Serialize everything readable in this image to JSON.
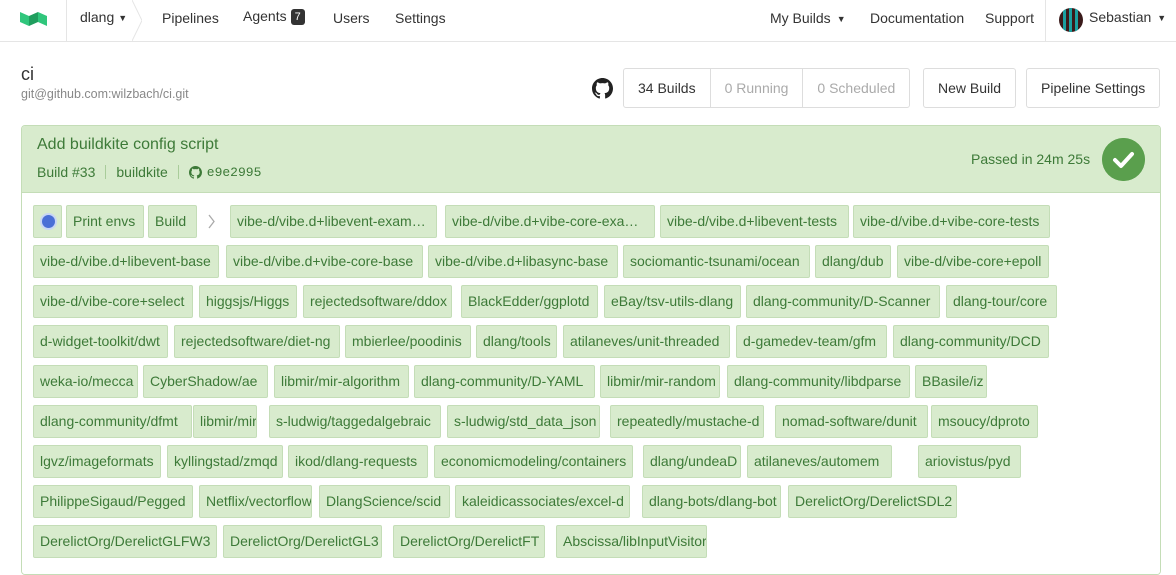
{
  "nav": {
    "org": "dlang",
    "links": {
      "pipelines": "Pipelines",
      "agents": "Agents",
      "users": "Users",
      "settings": "Settings"
    },
    "agents_count": "7",
    "my_builds": "My Builds",
    "documentation": "Documentation",
    "support": "Support",
    "user": "Sebastian"
  },
  "pipeline": {
    "name": "ci",
    "repo": "git@github.com:wilzbach/ci.git",
    "builds": "34 Builds",
    "running": "0 Running",
    "scheduled": "0 Scheduled",
    "new_build": "New Build",
    "settings": "Pipeline Settings"
  },
  "build": {
    "title": "Add buildkite config script",
    "number": "Build #33",
    "branch": "buildkite",
    "commit": "e9e2995",
    "status": "Passed in 24m 25s"
  },
  "colors": {
    "passed_bg": "#d8ebcd",
    "passed_text": "#3d7a38",
    "passed_check": "#5a9f4d"
  },
  "jobs": [
    "Print envs",
    "Build",
    "vibe-d/vibe.d+libevent-exam…",
    "vibe-d/vibe.d+vibe-core-exa…",
    "vibe-d/vibe.d+libevent-tests",
    "vibe-d/vibe.d+vibe-core-tests",
    "vibe-d/vibe.d+libevent-base",
    "vibe-d/vibe.d+vibe-core-base",
    "vibe-d/vibe.d+libasync-base",
    "sociomantic-tsunami/ocean",
    "dlang/dub",
    "vibe-d/vibe-core+epoll",
    "vibe-d/vibe-core+select",
    "higgsjs/Higgs",
    "rejectedsoftware/ddox",
    "BlackEdder/ggplotd",
    "eBay/tsv-utils-dlang",
    "dlang-community/D-Scanner",
    "dlang-tour/core",
    "d-widget-toolkit/dwt",
    "rejectedsoftware/diet-ng",
    "mbierlee/poodinis",
    "dlang/tools",
    "atilaneves/unit-threaded",
    "d-gamedev-team/gfm",
    "dlang-community/DCD",
    "weka-io/mecca",
    "CyberShadow/ae",
    "libmir/mir-algorithm",
    "dlang-community/D-YAML",
    "libmir/mir-random",
    "dlang-community/libdparse",
    "BBasile/iz",
    "dlang-community/dfmt",
    "libmir/mir",
    "s-ludwig/taggedalgebraic",
    "s-ludwig/std_data_json",
    "repeatedly/mustache-d",
    "nomad-software/dunit",
    "msoucy/dproto",
    "lgvz/imageformats",
    "kyllingstad/zmqd",
    "ikod/dlang-requests",
    "economicmodeling/containers",
    "dlang/undeaD",
    "atilaneves/automem",
    "ariovistus/pyd",
    "PhilippeSigaud/Pegged",
    "Netflix/vectorflow",
    "DlangScience/scid",
    "kaleidicassociates/excel-d",
    "dlang-bots/dlang-bot",
    "DerelictOrg/DerelictSDL2",
    "DerelictOrg/DerelictGLFW3",
    "DerelictOrg/DerelictGL3",
    "DerelictOrg/DerelictFT",
    "Abscissa/libInputVisitor"
  ]
}
